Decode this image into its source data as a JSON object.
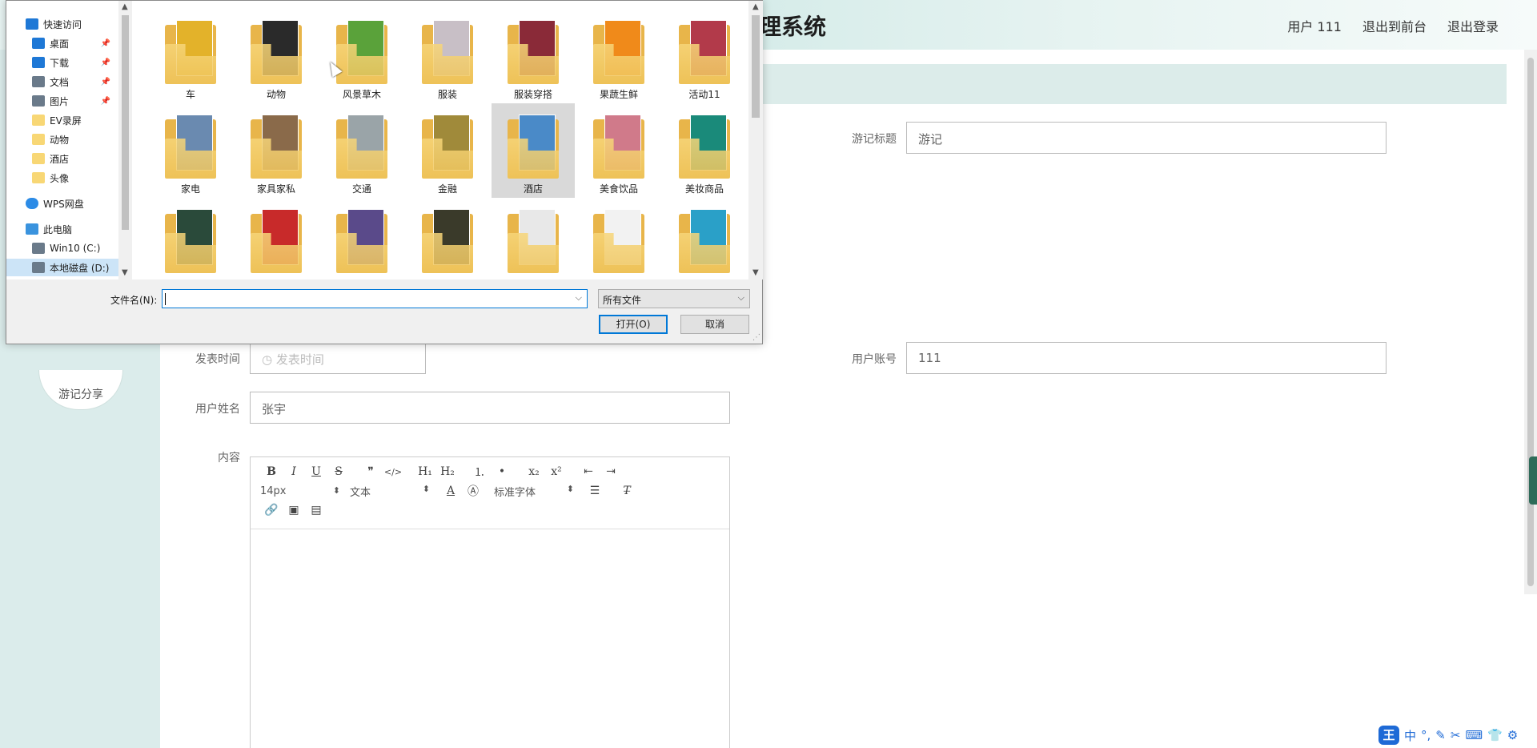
{
  "app": {
    "title": "管理系统",
    "nav": [
      "用户 111",
      "退出到前台",
      "退出登录"
    ],
    "sidebar_pill": "游记分享"
  },
  "form": {
    "title_label": "游记标题",
    "title_value": "游记",
    "time_label": "发表时间",
    "time_placeholder": "发表时间",
    "account_label": "用户账号",
    "account_value": "111",
    "name_label": "用户姓名",
    "name_value": "张宇",
    "content_label": "内容",
    "toolbar": {
      "row1": [
        "B",
        "I",
        "U",
        "S",
        "❞",
        "</>",
        "H₁",
        "H₂",
        "⒈",
        "•",
        "x₂",
        "x²",
        "⇤",
        "⇥"
      ],
      "font_size": "14px",
      "block_type": "文本",
      "font_family": "标准字体",
      "row3": [
        "🔗",
        "▣",
        "▤"
      ]
    }
  },
  "dialog": {
    "nav_items": [
      {
        "label": "快速访问",
        "icon": "star-icon",
        "pinned": false
      },
      {
        "label": "桌面",
        "icon": "desktop-icon",
        "pinned": true
      },
      {
        "label": "下载",
        "icon": "download-icon",
        "pinned": true
      },
      {
        "label": "文档",
        "icon": "document-icon",
        "pinned": true
      },
      {
        "label": "图片",
        "icon": "picture-icon",
        "pinned": true
      },
      {
        "label": "EV录屏",
        "icon": "folder-icon",
        "pinned": false
      },
      {
        "label": "动物",
        "icon": "folder-icon",
        "pinned": false
      },
      {
        "label": "酒店",
        "icon": "folder-icon",
        "pinned": false
      },
      {
        "label": "头像",
        "icon": "folder-icon",
        "pinned": false
      },
      {
        "label": "WPS网盘",
        "icon": "cloud-icon",
        "pinned": false
      },
      {
        "label": "此电脑",
        "icon": "computer-icon",
        "pinned": false
      },
      {
        "label": "Win10 (C:)",
        "icon": "drive-icon",
        "pinned": false
      },
      {
        "label": "本地磁盘 (D:)",
        "icon": "drive-icon",
        "pinned": false
      }
    ],
    "folders": [
      {
        "name": "车",
        "color": "#e3b22a"
      },
      {
        "name": "动物",
        "color": "#2a2a2a"
      },
      {
        "name": "风景草木",
        "color": "#5aa23a"
      },
      {
        "name": "服装",
        "color": "#c8bfc6"
      },
      {
        "name": "服装穿搭",
        "color": "#8a2a38"
      },
      {
        "name": "果蔬生鲜",
        "color": "#f08a1a"
      },
      {
        "name": "活动11",
        "color": "#b23a4a"
      },
      {
        "name": "家电",
        "color": "#6a8ab0"
      },
      {
        "name": "家具家私",
        "color": "#8a6a4a"
      },
      {
        "name": "交通",
        "color": "#9aa4a8"
      },
      {
        "name": "金融",
        "color": "#a08a3a"
      },
      {
        "name": "酒店",
        "color": "#4a8ac8"
      },
      {
        "name": "美食饮品",
        "color": "#d07a8a"
      },
      {
        "name": "美妆商品",
        "color": "#1a8a7a"
      },
      {
        "name": "",
        "color": "#2a4a3a"
      },
      {
        "name": "",
        "color": "#c82a2a"
      },
      {
        "name": "",
        "color": "#5a4a8a"
      },
      {
        "name": "",
        "color": "#3a3a2a"
      },
      {
        "name": "",
        "color": "#e8e8e8"
      },
      {
        "name": "",
        "color": "#f2f2f2"
      },
      {
        "name": "",
        "color": "#2aa0c8"
      }
    ],
    "filename_label": "文件名(N):",
    "filename_value": "",
    "filetype": "所有文件",
    "open_button": "打开(O)",
    "cancel_button": "取消"
  },
  "ime": {
    "logo": "王",
    "mode": "中"
  }
}
